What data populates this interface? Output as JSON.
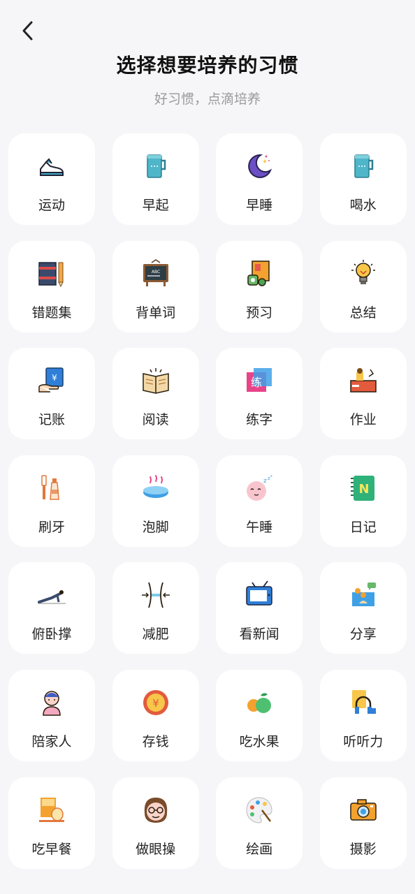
{
  "header": {
    "title": "选择想要培养的习惯",
    "subtitle": "好习惯，点滴培养"
  },
  "habits": [
    {
      "label": "运动",
      "icon": "sneaker-icon"
    },
    {
      "label": "早起",
      "icon": "cup-icon"
    },
    {
      "label": "早睡",
      "icon": "moon-icon"
    },
    {
      "label": "喝水",
      "icon": "cup-icon"
    },
    {
      "label": "错题集",
      "icon": "notebook-pencil-icon"
    },
    {
      "label": "背单词",
      "icon": "blackboard-icon"
    },
    {
      "label": "预习",
      "icon": "book-stack-icon"
    },
    {
      "label": "总结",
      "icon": "lightbulb-icon"
    },
    {
      "label": "记账",
      "icon": "money-hand-icon"
    },
    {
      "label": "阅读",
      "icon": "open-book-icon"
    },
    {
      "label": "练字",
      "icon": "calligraphy-icon"
    },
    {
      "label": "作业",
      "icon": "desk-lamp-icon"
    },
    {
      "label": "刷牙",
      "icon": "toothbrush-icon"
    },
    {
      "label": "泡脚",
      "icon": "foot-basin-icon"
    },
    {
      "label": "午睡",
      "icon": "sleepy-face-icon"
    },
    {
      "label": "日记",
      "icon": "diary-icon"
    },
    {
      "label": "俯卧撑",
      "icon": "pushup-icon"
    },
    {
      "label": "减肥",
      "icon": "waist-icon"
    },
    {
      "label": "看新闻",
      "icon": "tv-icon"
    },
    {
      "label": "分享",
      "icon": "share-people-icon"
    },
    {
      "label": "陪家人",
      "icon": "person-icon"
    },
    {
      "label": "存钱",
      "icon": "coin-icon"
    },
    {
      "label": "吃水果",
      "icon": "fruit-icon"
    },
    {
      "label": "听听力",
      "icon": "headphones-icon"
    },
    {
      "label": "吃早餐",
      "icon": "breakfast-icon"
    },
    {
      "label": "做眼操",
      "icon": "glasses-face-icon"
    },
    {
      "label": "绘画",
      "icon": "palette-icon"
    },
    {
      "label": "摄影",
      "icon": "camera-icon"
    }
  ]
}
